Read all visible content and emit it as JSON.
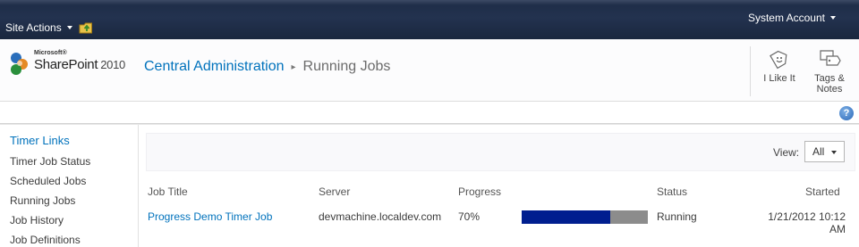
{
  "topbar": {
    "site_actions_label": "Site Actions",
    "account_label": "System Account"
  },
  "logo": {
    "microsoft_label": "Microsoft®",
    "product_label": "SharePoint",
    "version_label": "2010"
  },
  "breadcrumb": {
    "root_label": "Central Administration",
    "separator": "▸",
    "current_label": "Running Jobs"
  },
  "social": {
    "like_label": "I Like It",
    "tags_label_line1": "Tags &",
    "tags_label_line2": "Notes"
  },
  "help": {
    "label": "?"
  },
  "leftnav": {
    "heading": "Timer Links",
    "items": [
      {
        "label": "Timer Job Status"
      },
      {
        "label": "Scheduled Jobs"
      },
      {
        "label": "Running Jobs"
      },
      {
        "label": "Job History"
      },
      {
        "label": "Job Definitions"
      }
    ]
  },
  "viewbar": {
    "label": "View:",
    "selected": "All"
  },
  "table": {
    "columns": {
      "job_title": "Job Title",
      "server": "Server",
      "progress": "Progress",
      "status": "Status",
      "started": "Started"
    },
    "rows": [
      {
        "job_title": "Progress Demo Timer Job",
        "server": "devmachine.localdev.com",
        "progress_text": "70%",
        "progress_value": 0.7,
        "status": "Running",
        "started_line1": "1/21/2012 10:12",
        "started_line2": "AM"
      }
    ]
  },
  "colors": {
    "topbar": "#1d2c46",
    "link": "#0072bc",
    "progress_fill": "#001e8f",
    "progress_track": "#8c8c8c"
  },
  "icons": {
    "navigate_up": "folder-up-icon",
    "like": "like-tag-icon",
    "tags": "tags-notes-icon",
    "help": "help-icon"
  }
}
